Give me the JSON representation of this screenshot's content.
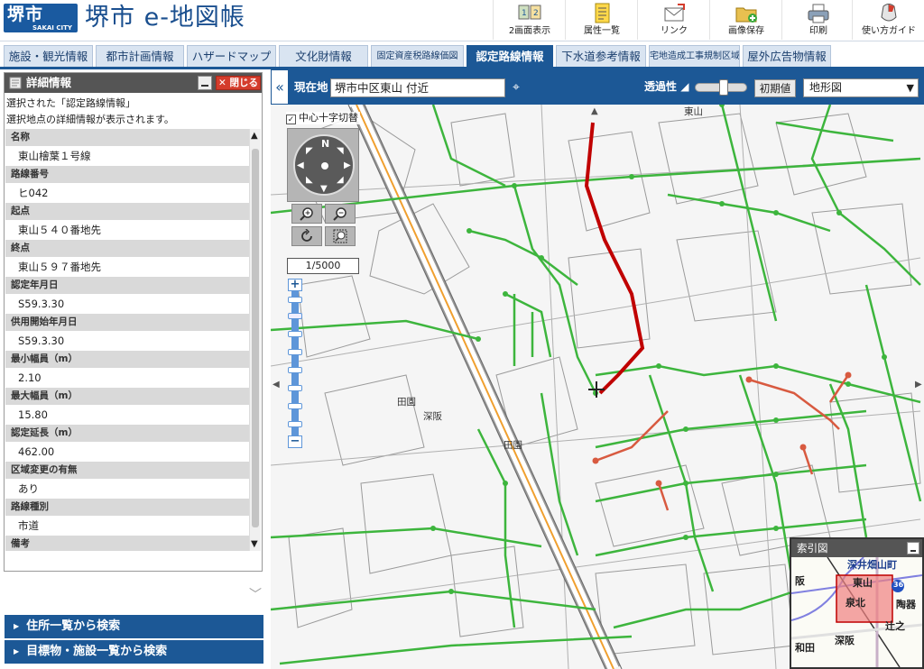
{
  "header": {
    "logo_text": "堺市",
    "logo_sub": "SAKAI CITY",
    "app_title": "堺市 e-地図帳",
    "tools": [
      {
        "label": "2画面表示",
        "icon": "dual-screen-icon"
      },
      {
        "label": "属性一覧",
        "icon": "attribute-list-icon"
      },
      {
        "label": "リンク",
        "icon": "link-icon"
      },
      {
        "label": "画像保存",
        "icon": "save-image-icon"
      },
      {
        "label": "印刷",
        "icon": "print-icon"
      },
      {
        "label": "使い方ガイド",
        "icon": "guide-icon"
      }
    ]
  },
  "tabs": [
    {
      "label": "施設・観光情報",
      "active": false
    },
    {
      "label": "都市計画情報",
      "active": false
    },
    {
      "label": "ハザードマップ",
      "active": false
    },
    {
      "label": "文化財情報",
      "active": false
    },
    {
      "label": "固定資産税路線価図",
      "active": false
    },
    {
      "label": "認定路線情報",
      "active": true
    },
    {
      "label": "下水道参考情報",
      "active": false
    },
    {
      "label": "宅地造成工事規制区域",
      "active": false
    },
    {
      "label": "屋外広告物情報",
      "active": false
    }
  ],
  "detail": {
    "title": "詳細情報",
    "close_label": "閉じる",
    "intro_1": "選択された「認定路線情報」",
    "intro_2": "選択地点の詳細情報が表示されます。",
    "fields": [
      {
        "label": "名称",
        "value": "東山檜葉１号線"
      },
      {
        "label": "路線番号",
        "value": "ヒ042"
      },
      {
        "label": "起点",
        "value": "東山５４０番地先"
      },
      {
        "label": "終点",
        "value": "東山５９７番地先"
      },
      {
        "label": "認定年月日",
        "value": "S59.3.30"
      },
      {
        "label": "供用開始年月日",
        "value": "S59.3.30"
      },
      {
        "label": "最小幅員（m）",
        "value": "2.10"
      },
      {
        "label": "最大幅員（m）",
        "value": "15.80"
      },
      {
        "label": "認定延長（m）",
        "value": "462.00"
      },
      {
        "label": "区域変更の有無",
        "value": "あり"
      },
      {
        "label": "路線種別",
        "value": "市道"
      },
      {
        "label": "備考",
        "value": ""
      }
    ]
  },
  "search": {
    "address_label": "住所一覧から検索",
    "landmark_label": "目標物・施設一覧から検索"
  },
  "map_toolbar": {
    "location_label": "現在地",
    "location_value": "堺市中区東山 付近",
    "transparency_label": "透過性",
    "transparency_level": 0.55,
    "reset_label": "初期値",
    "map_type": "地形図"
  },
  "map": {
    "center_toggle_label": "中心十字切替",
    "center_toggle_checked": true,
    "compass_label": "N",
    "scale": "1/5000",
    "labels": {
      "higashiyama": "東山",
      "den1": "田園",
      "den2": "田園",
      "fukasaka": "深阪"
    },
    "colors": {
      "route": "#c00000",
      "other_routes": "#d85a40",
      "roads": "#33b233",
      "railway": "#f0a030"
    }
  },
  "index_map": {
    "title": "索引図",
    "labels": [
      "深井畑山町",
      "東山",
      "泉北",
      "陶器",
      "深阪",
      "辻之",
      "和田",
      "阪",
      "36"
    ]
  }
}
